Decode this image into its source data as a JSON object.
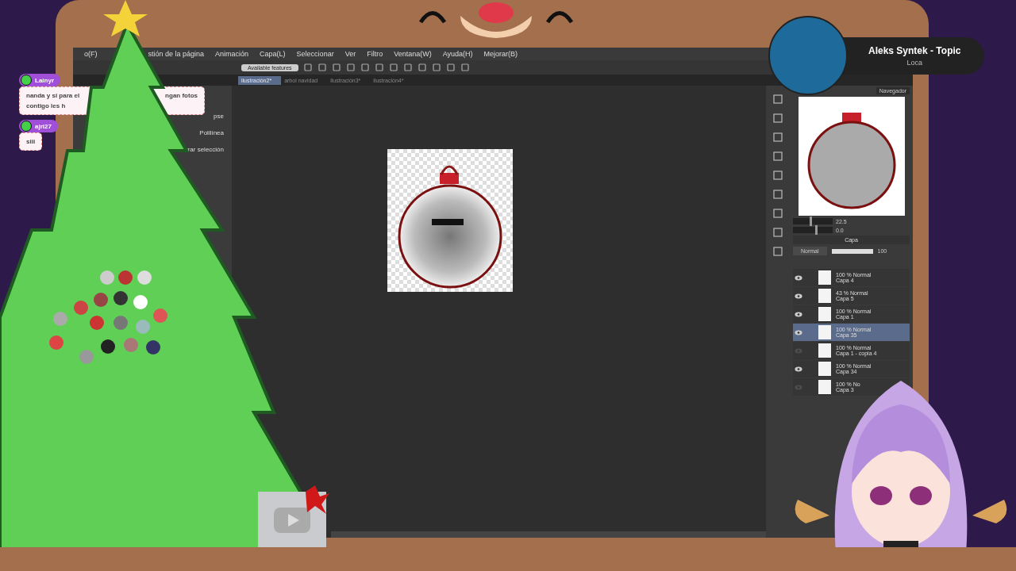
{
  "app": {
    "menu": [
      "o(F)",
      "stión de la página",
      "Animación",
      "Capa(L)",
      "Seleccionar",
      "Ver",
      "Filtro",
      "Ventana(W)",
      "Ayuda(H)",
      "Mejorar(B)"
    ],
    "toolbar": {
      "features_button": "Available features"
    },
    "tabs": [
      {
        "label": "ilustración2*",
        "selected": true
      },
      {
        "label": "arbol navidad",
        "selected": false
      },
      {
        "label": "ilustración3*",
        "selected": false
      },
      {
        "label": "ilustración4*",
        "selected": false
      }
    ],
    "tool_panel": {
      "items": [
        "pse",
        "Polilínea",
        "rrar selección"
      ]
    },
    "navigator": {
      "tabs": [
        "Navegador"
      ],
      "zoom": {
        "level": 0.42,
        "reading": "22.5"
      },
      "rotation": {
        "level": 0.55,
        "reading": "0.0"
      }
    },
    "layer_panel": {
      "tab": "Capa",
      "blend_mode": "Normal",
      "opacity": {
        "level": 1,
        "reading": "100"
      },
      "layers": [
        {
          "mode": "100 % Normal",
          "name": "Capa 4",
          "visible": true,
          "selected": false
        },
        {
          "mode": "43 % Normal",
          "name": "Capa 5",
          "visible": true,
          "selected": false
        },
        {
          "mode": "100 % Normal",
          "name": "Capa 1",
          "visible": true,
          "selected": false
        },
        {
          "mode": "100 % Normal",
          "name": "Capa 35",
          "visible": true,
          "selected": true
        },
        {
          "mode": "100 % Normal",
          "name": "Capa 1 - copia 4",
          "visible": false,
          "selected": false
        },
        {
          "mode": "100 % Normal",
          "name": "Capa 34",
          "visible": true,
          "selected": false
        },
        {
          "mode": "100 % No",
          "name": "Capa 3",
          "visible": false,
          "selected": false
        }
      ]
    }
  },
  "chat": [
    {
      "user": "Lainyr",
      "lines": [
        "nanda y si para el",
        "contigo les h"
      ],
      "right_text": "ngan fotos"
    },
    {
      "user": "ajri27",
      "lines": [
        "siii"
      ]
    }
  ],
  "now_playing": {
    "artist": "Aleks Syntek - Topic",
    "title": "Loca"
  }
}
